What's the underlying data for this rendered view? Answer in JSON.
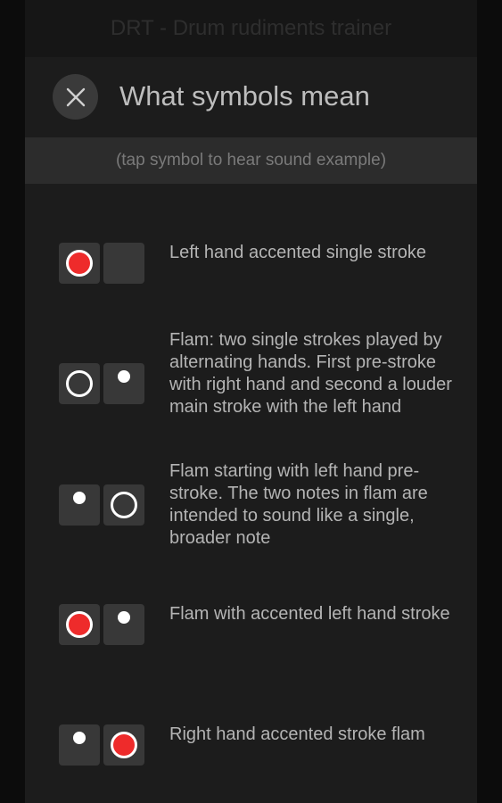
{
  "app": {
    "title": "DRT - Drum rudiments trainer"
  },
  "dialog": {
    "title": "What symbols mean",
    "hint": "(tap symbol to hear sound example)"
  },
  "colors": {
    "accent": "#ee2b2b",
    "dialog_bg": "#1c1c1c",
    "cell_bg": "#383838"
  },
  "legend": [
    {
      "left": "accented-stroke",
      "right": "empty",
      "description": "Left hand accented single stroke"
    },
    {
      "left": "open-stroke",
      "right": "grace-note",
      "description": "Flam: two single strokes played by alternating hands. First pre-stroke with right hand and second a louder main stroke with the left hand"
    },
    {
      "left": "grace-note",
      "right": "open-stroke",
      "description": "Flam starting with left hand pre-stroke. The two notes in flam are intended to sound like a single, broader note"
    },
    {
      "left": "accented-stroke",
      "right": "grace-note",
      "description": "Flam with accented left hand stroke"
    },
    {
      "left": "grace-note",
      "right": "accented-stroke",
      "description": "Right hand accented stroke flam"
    }
  ]
}
